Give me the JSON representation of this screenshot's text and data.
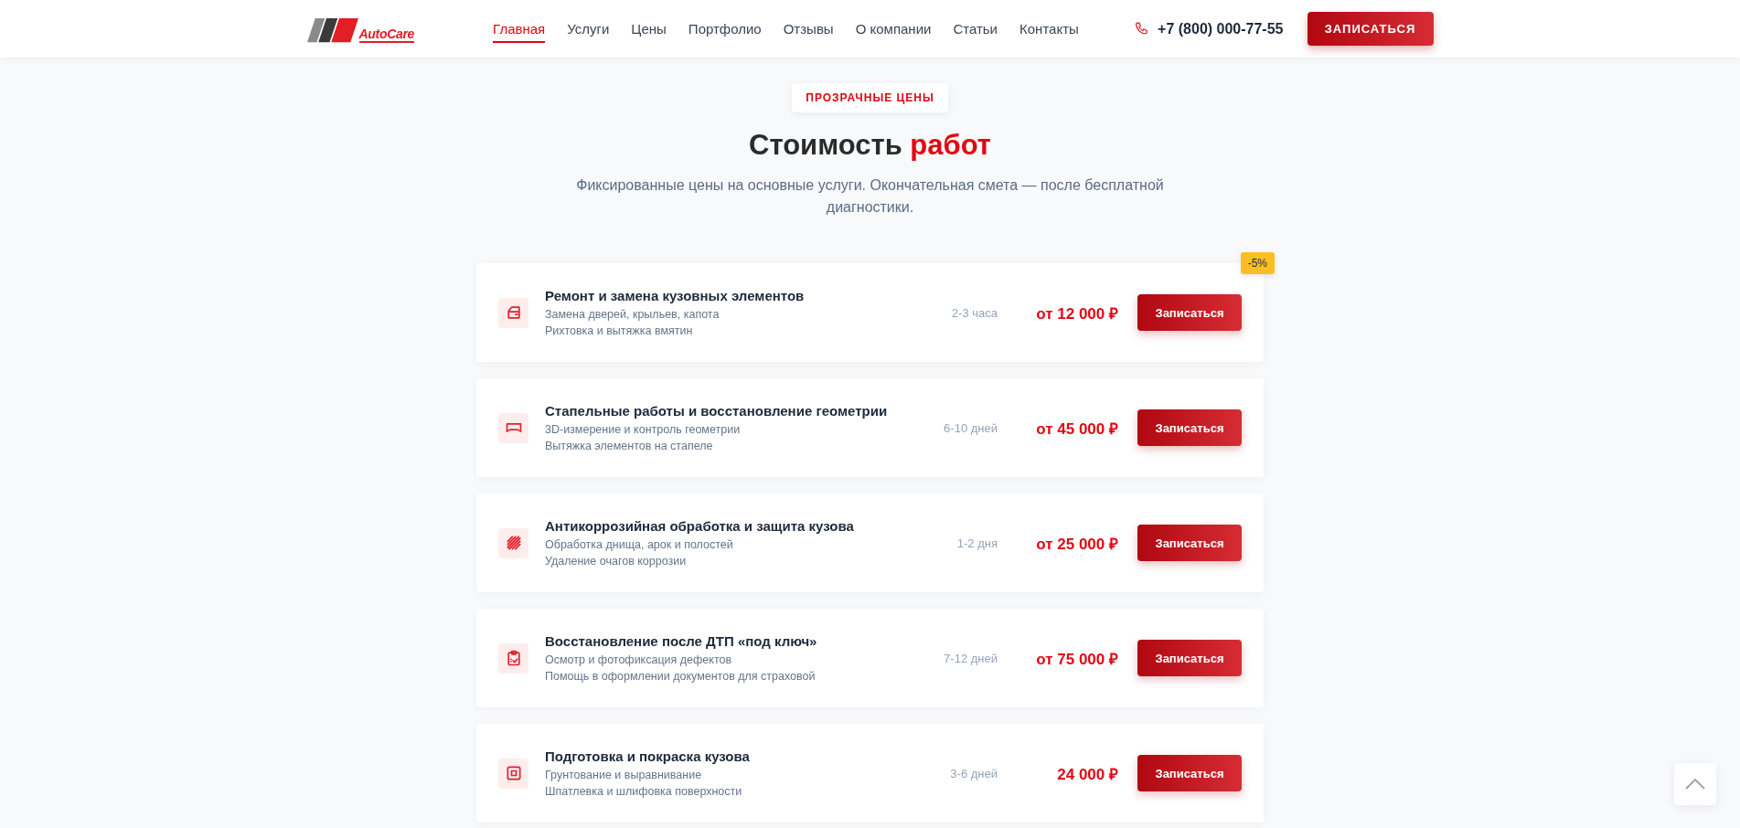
{
  "header": {
    "logo": "AutoCare",
    "nav": [
      {
        "label": "Главная",
        "selected": true
      },
      {
        "label": "Услуги",
        "selected": false
      },
      {
        "label": "Цены",
        "selected": false
      },
      {
        "label": "Портфолио",
        "selected": false
      },
      {
        "label": "Отзывы",
        "selected": false
      },
      {
        "label": "О компании",
        "selected": false
      },
      {
        "label": "Статьи",
        "selected": false
      },
      {
        "label": "Контакты",
        "selected": false
      }
    ],
    "phone": "+7 (800) 000-77-55",
    "cta": "ЗАПИСАТЬСЯ"
  },
  "pricing": {
    "tag": "ПРОЗРАЧНЫЕ ЦЕНЫ",
    "title": "Стоимость",
    "title_accent": "работ",
    "subtitle": "Фиксированные цены на основные услуги. Окончательная смета — после бесплатной диагностики.",
    "services": [
      {
        "title": "Ремонт и замена кузовных элементов",
        "details": [
          "Замена дверей, крыльев, капота",
          "Рихтовка и вытяжка вмятин"
        ],
        "duration": "2-3 часа",
        "price": "от 12 000 ₽",
        "button": "Записаться",
        "badge": "-5%"
      },
      {
        "title": "Стапельные работы и восстановление геометрии",
        "details": [
          "3D-измерение и контроль геометрии",
          "Вытяжка элементов на стапеле"
        ],
        "duration": "6-10 дней",
        "price": "от 45 000 ₽",
        "button": "Записаться"
      },
      {
        "title": "Антикоррозийная обработка и защита кузова",
        "details": [
          "Обработка днища, арок и полостей",
          "Удаление очагов коррозии"
        ],
        "duration": "1-2 дня",
        "price": "от 25 000 ₽",
        "button": "Записаться"
      },
      {
        "title": "Восстановление после ДТП «под ключ»",
        "details": [
          "Осмотр и фотофиксация дефектов",
          "Помощь в оформлении документов для страховой"
        ],
        "duration": "7-12 дней",
        "price": "от 75 000 ₽",
        "button": "Записаться"
      },
      {
        "title": "Подготовка и покраска кузова",
        "details": [
          "Грунтование и выравнивание",
          "Шпатлевка и шлифовка поверхности"
        ],
        "duration": "3-6 дней",
        "price": "24 000 ₽",
        "button": "Записаться"
      }
    ]
  }
}
